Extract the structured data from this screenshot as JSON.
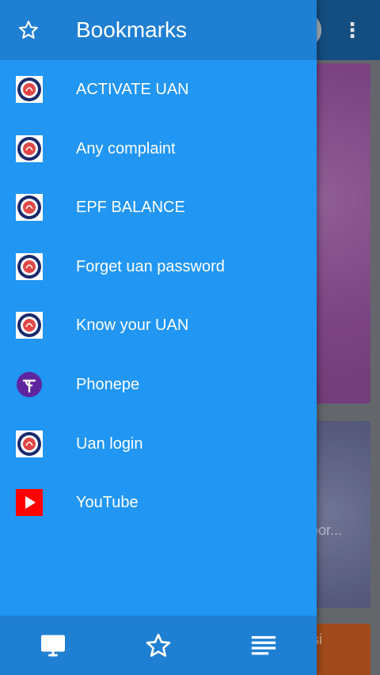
{
  "drawer": {
    "title": "Bookmarks",
    "items": [
      {
        "label": "ACTIVATE UAN",
        "icon": "epfo-logo-icon"
      },
      {
        "label": "Any complaint",
        "icon": "epfo-logo-icon"
      },
      {
        "label": "EPF BALANCE",
        "icon": "epfo-logo-icon"
      },
      {
        "label": "Forget uan password",
        "icon": "epfo-logo-icon"
      },
      {
        "label": "Know your UAN",
        "icon": "epfo-logo-icon"
      },
      {
        "label": "Phonepe",
        "icon": "phonepe-icon"
      },
      {
        "label": "Uan login",
        "icon": "epfo-logo-icon"
      },
      {
        "label": "YouTube",
        "icon": "youtube-icon"
      }
    ],
    "bottom_bar": {
      "buttons": [
        "desktop-icon",
        "star-icon",
        "list-icon"
      ]
    }
  },
  "background": {
    "card_2_text": "oor...",
    "card_3_text": "si"
  },
  "colors": {
    "drawer": "#2196f3",
    "drawer_header": "#1f7fd2",
    "phonepe": "#5f259f",
    "youtube": "#ff0000"
  }
}
